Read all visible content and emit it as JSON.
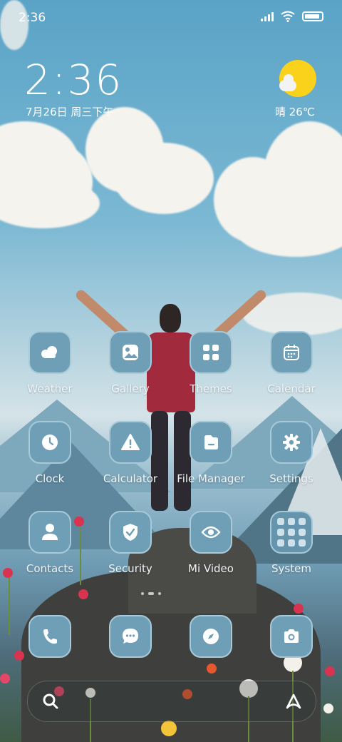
{
  "status_bar": {
    "time": "2:36"
  },
  "widget": {
    "time": "2:36",
    "date": "7月26日 周三下午",
    "weather": "晴 26℃"
  },
  "apps": [
    {
      "label": "Weather",
      "icon": "weather-icon"
    },
    {
      "label": "Gallery",
      "icon": "gallery-icon"
    },
    {
      "label": "Themes",
      "icon": "themes-icon"
    },
    {
      "label": "Calendar",
      "icon": "calendar-icon"
    },
    {
      "label": "Clock",
      "icon": "clock-icon"
    },
    {
      "label": "Calculator",
      "icon": "calculator-icon"
    },
    {
      "label": "File Manager",
      "icon": "file-manager-icon"
    },
    {
      "label": "Settings",
      "icon": "settings-icon"
    },
    {
      "label": "Contacts",
      "icon": "contacts-icon"
    },
    {
      "label": "Security",
      "icon": "security-icon"
    },
    {
      "label": "Mi Video",
      "icon": "video-icon"
    },
    {
      "label": "System",
      "icon": "folder-icon"
    }
  ],
  "dock": [
    {
      "icon": "phone-icon"
    },
    {
      "icon": "messages-icon"
    },
    {
      "icon": "browser-icon"
    },
    {
      "icon": "camera-icon"
    }
  ],
  "colors": {
    "tile": "#6e9fb6",
    "sun": "#fbd21b",
    "jersey": "#a22a3d"
  }
}
